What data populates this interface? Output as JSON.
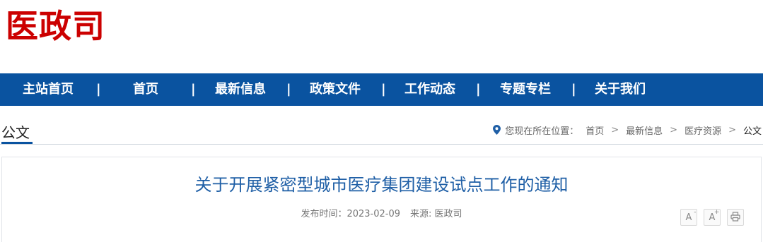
{
  "site": {
    "logo_text": "医政司"
  },
  "nav": {
    "items": [
      "主站首页",
      "首页",
      "最新信息",
      "政策文件",
      "工作动态",
      "专题专栏",
      "关于我们"
    ],
    "separator": "|"
  },
  "section": {
    "title": "公文"
  },
  "breadcrumb": {
    "prefix": "您现在所在位置：",
    "items": [
      "首页",
      "最新信息",
      "医疗资源",
      "公文"
    ],
    "separator": ">"
  },
  "article": {
    "title": "关于开展紧密型城市医疗集团建设试点工作的通知",
    "date_label": "发布时间：",
    "date": "2023-02-09",
    "source_label": "来源:",
    "source": "医政司"
  },
  "tools": {
    "font_decrease": "A",
    "font_decrease_sup": "-",
    "font_increase": "A",
    "font_increase_sup": "+"
  },
  "colors": {
    "logo": "#cc0000",
    "nav_bg": "#0a53a0",
    "title": "#1f5fa6"
  }
}
